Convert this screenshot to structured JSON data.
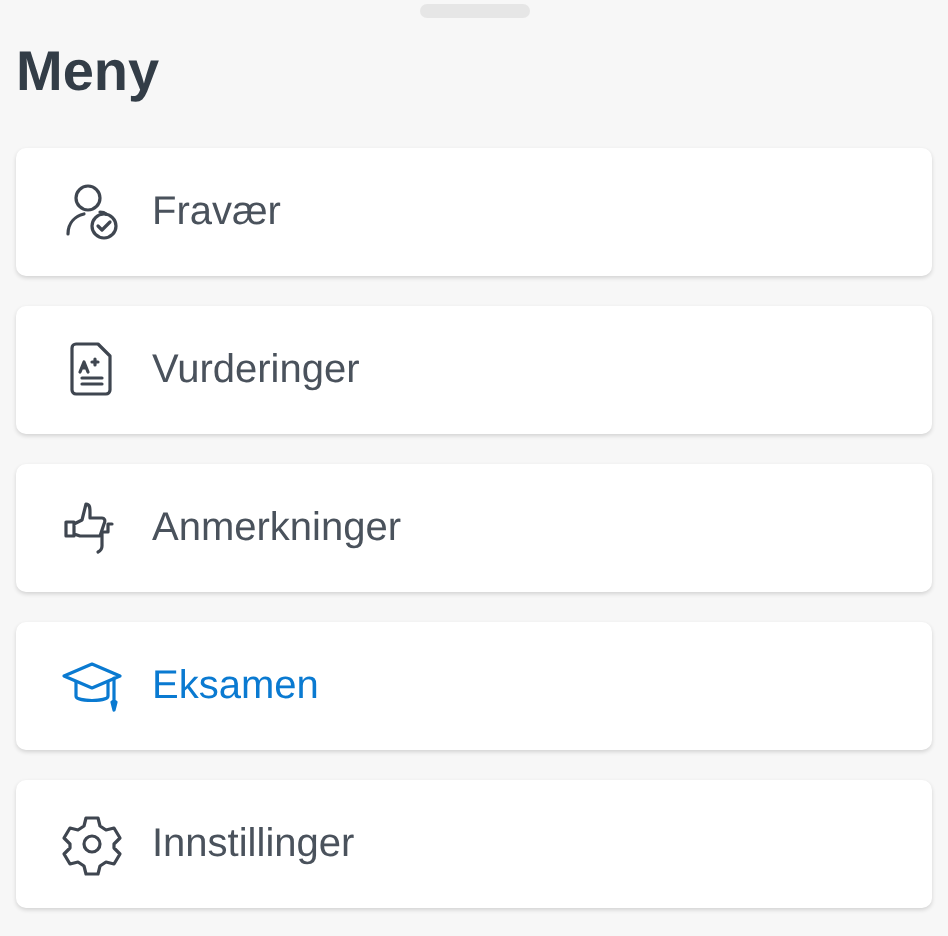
{
  "title": "Meny",
  "items": [
    {
      "kind": "absence",
      "label": "Fravær",
      "selected": false
    },
    {
      "kind": "grades",
      "label": "Vurderinger",
      "selected": false
    },
    {
      "kind": "remarks",
      "label": "Anmerkninger",
      "selected": false
    },
    {
      "kind": "exam",
      "label": "Eksamen",
      "selected": true
    },
    {
      "kind": "settings",
      "label": "Innstillinger",
      "selected": false
    }
  ]
}
